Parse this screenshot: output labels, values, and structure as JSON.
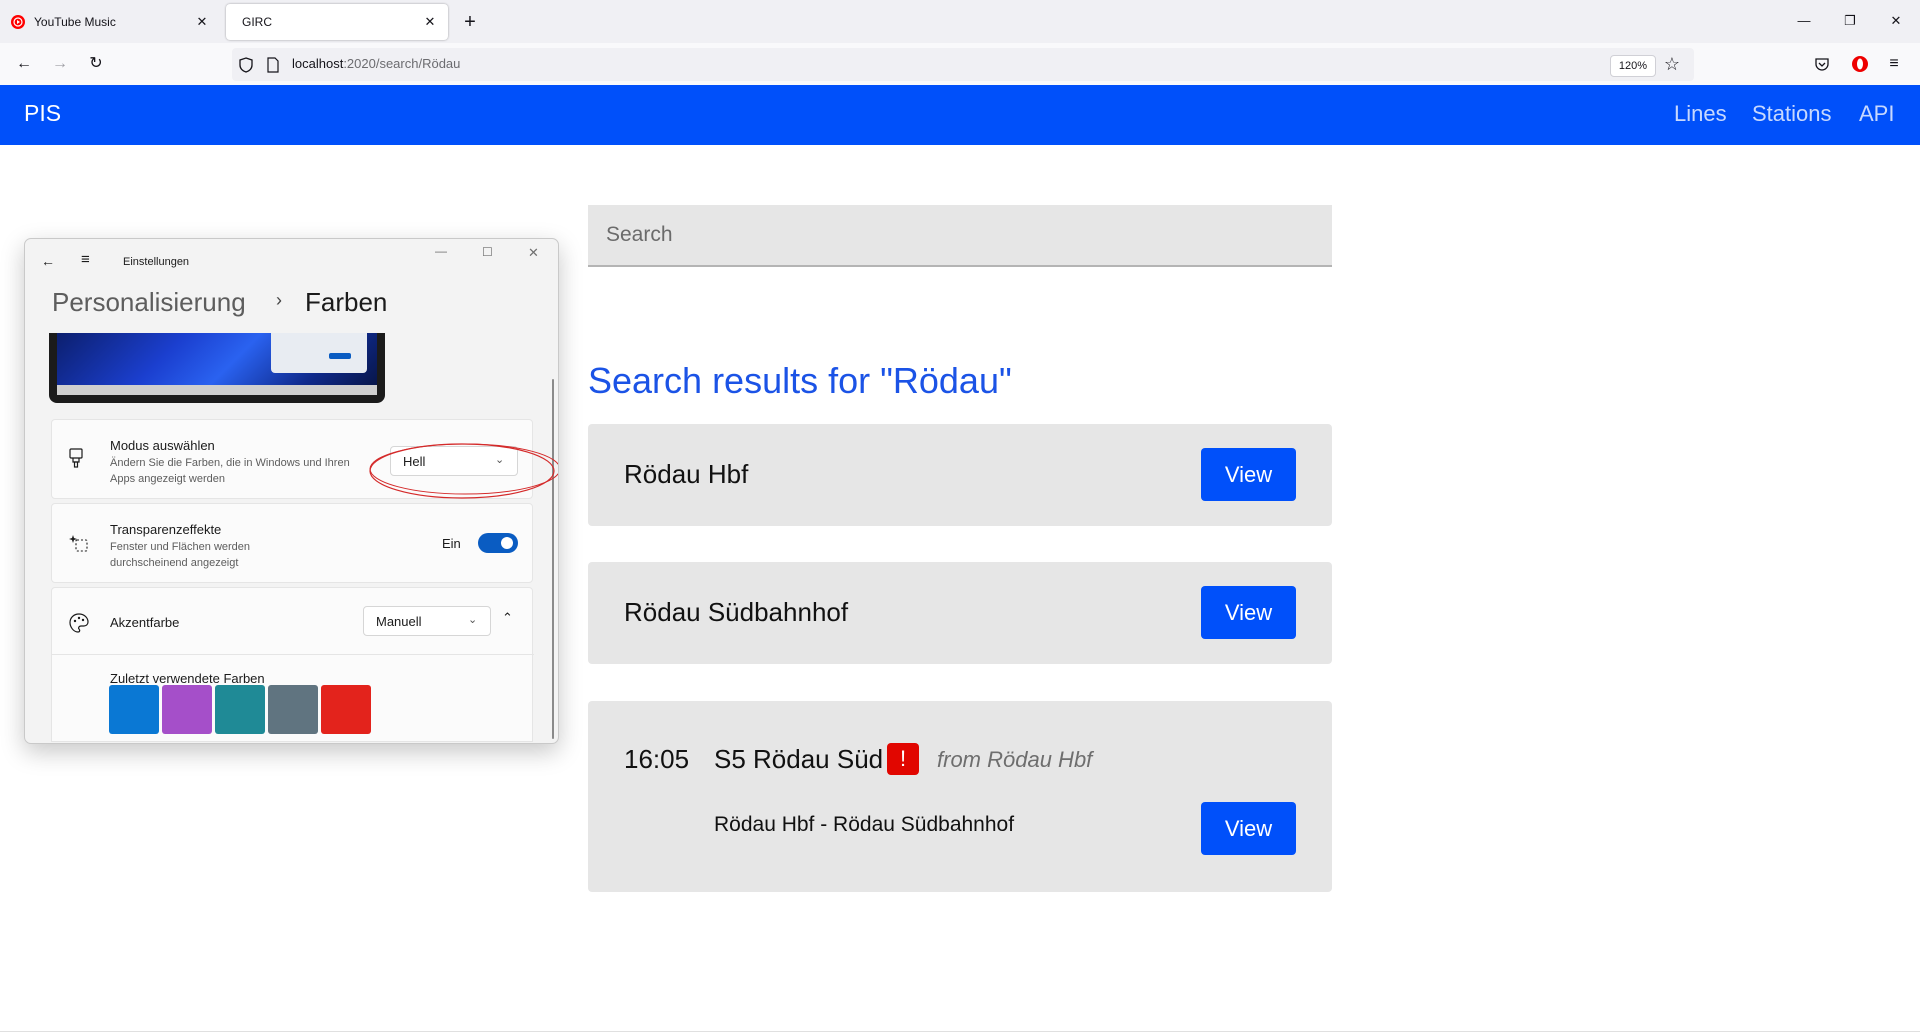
{
  "browser": {
    "tabs": [
      {
        "label": "YouTube Music"
      },
      {
        "label": "GIRC"
      }
    ],
    "url_host": "localhost",
    "url_rest": ":2020/search/Rödau",
    "zoom": "120%"
  },
  "site": {
    "brand": "PIS",
    "nav": [
      "Lines",
      "Stations",
      "API"
    ],
    "search_placeholder": "Search",
    "results_heading": "Search results for \"Rödau\"",
    "results": [
      {
        "title": "Rödau Hbf",
        "button": "View"
      },
      {
        "title": "Rödau Südbahnhof",
        "button": "View"
      }
    ],
    "departure": {
      "time": "16:05",
      "line": "S5 Rödau Süd",
      "alert": "!",
      "from": "from Rödau Hbf",
      "route": "Rödau Hbf - Rödau Südbahnhof",
      "button": "View"
    }
  },
  "settings": {
    "window_title": "Einstellungen",
    "breadcrumb_parent": "Personalisierung",
    "breadcrumb_current": "Farben",
    "mode": {
      "label": "Modus auswählen",
      "desc": "Ändern Sie die Farben, die in Windows und Ihren Apps angezeigt werden",
      "value": "Hell"
    },
    "transparency": {
      "label": "Transparenzeffekte",
      "desc": "Fenster und Flächen werden durchscheinend angezeigt",
      "state": "Ein",
      "on": true
    },
    "accent": {
      "label": "Akzentfarbe",
      "value": "Manuell"
    },
    "recent_colors_label": "Zuletzt verwendete Farben",
    "recent_colors": [
      "#0a78d4",
      "#a54fc9",
      "#1f8a96",
      "#607480",
      "#e3231c"
    ]
  }
}
